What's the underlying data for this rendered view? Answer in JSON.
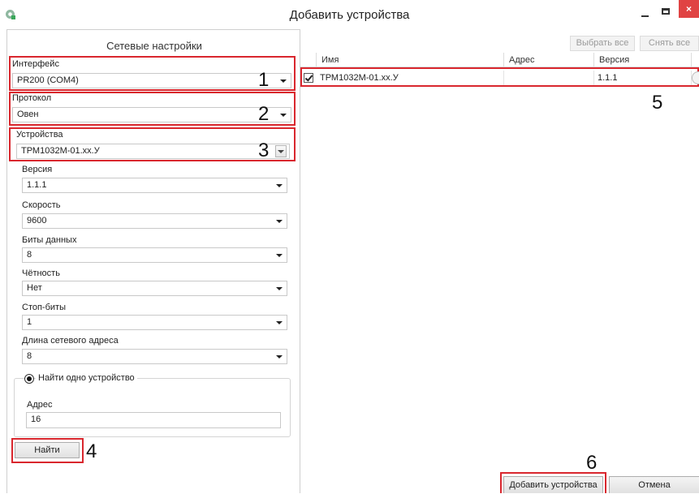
{
  "window": {
    "title": "Добавить устройства",
    "close_glyph": "×",
    "accent_close": "#e04343",
    "icon": "app-gear-icon"
  },
  "left": {
    "header": "Сетевые настройки",
    "interface": {
      "label": "Интерфейс",
      "value": "PR200 (COM4)",
      "marker": "1"
    },
    "protocol": {
      "label": "Протокол",
      "value": "Овен",
      "marker": "2"
    },
    "devices": {
      "label": "Устройства",
      "value": "ТРМ1032М-01.хх.У",
      "marker": "3"
    },
    "version": {
      "label": "Версия",
      "value": "1.1.1"
    },
    "speed": {
      "label": "Скорость",
      "value": "9600"
    },
    "data_bits": {
      "label": "Биты данных",
      "value": "8"
    },
    "parity": {
      "label": "Чётность",
      "value": "Нет"
    },
    "stop_bits": {
      "label": "Стоп-биты",
      "value": "1"
    },
    "address_length": {
      "label": "Длина сетевого адреса",
      "value": "8"
    },
    "find_one": {
      "label": "Найти одно устройство"
    },
    "address": {
      "label": "Адрес",
      "value": "16"
    },
    "find_button": {
      "label": "Найти",
      "marker": "4"
    }
  },
  "right": {
    "select_all": "Выбрать все",
    "clear_all": "Снять все",
    "columns": [
      "Имя",
      "Адрес",
      "Версия"
    ],
    "rows": [
      {
        "checked": true,
        "name": "ТРМ1032М-01.хх.У",
        "address": "",
        "version": "1.1.1"
      }
    ],
    "row_marker": "5",
    "add_button": {
      "label": "Добавить устройства",
      "marker": "6"
    },
    "cancel_button": {
      "label": "Отмена"
    }
  },
  "colors": {
    "highlight_red": "#d9272e"
  }
}
